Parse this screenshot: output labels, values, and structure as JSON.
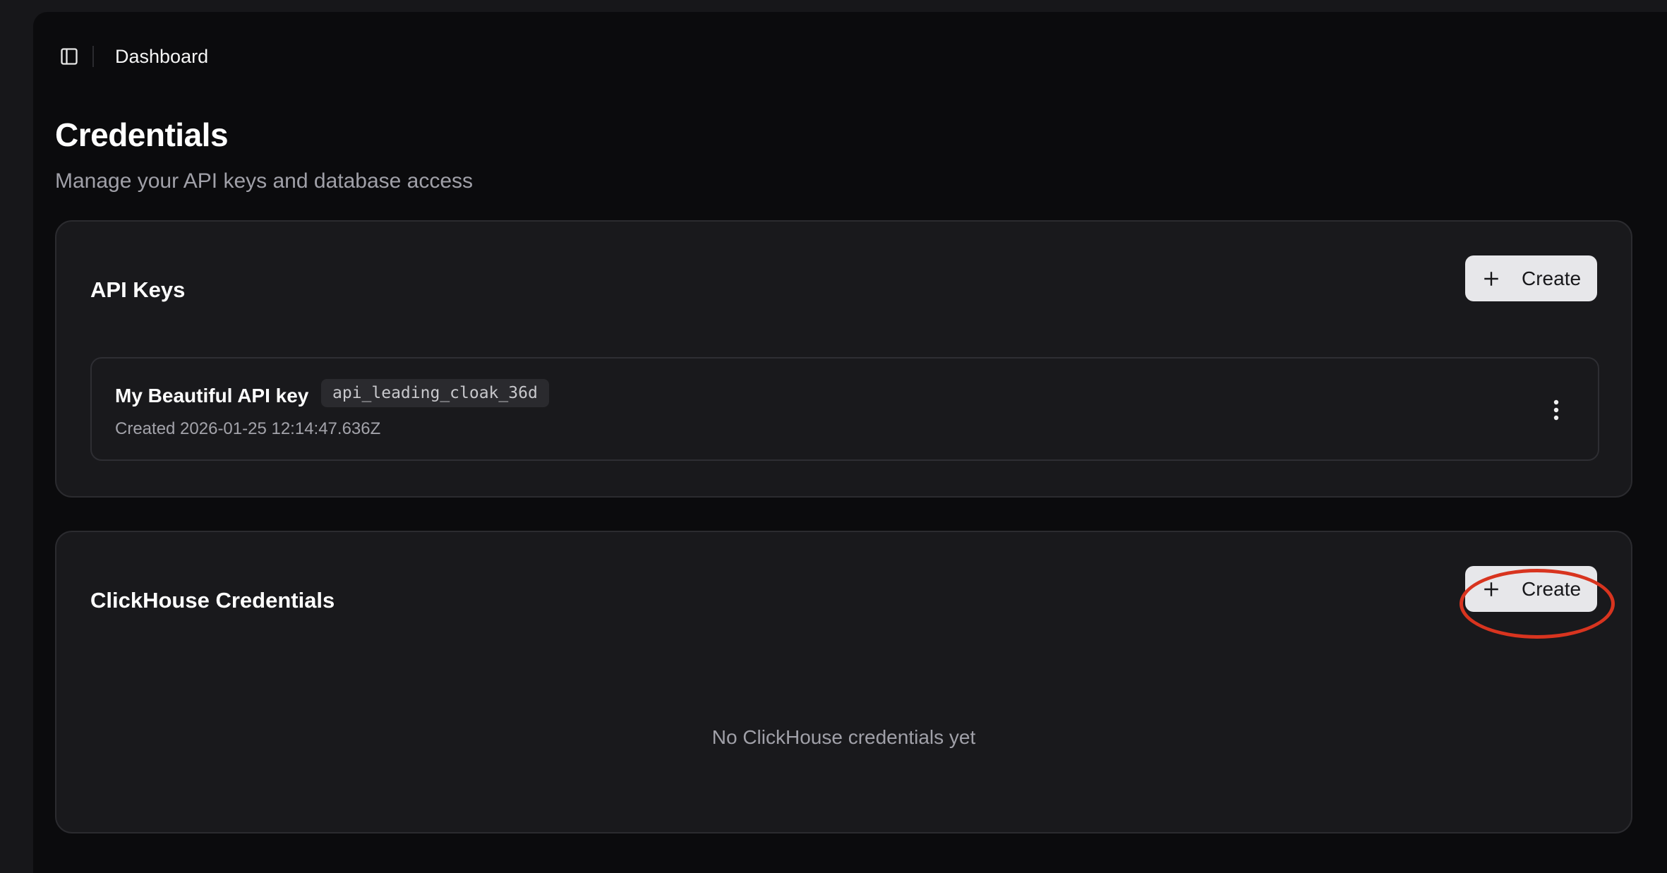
{
  "header": {
    "title": "Dashboard",
    "toggle_icon": "sidebar-toggle-icon"
  },
  "page": {
    "title": "Credentials",
    "subtitle": "Manage your API keys and database access"
  },
  "api_keys": {
    "title": "API Keys",
    "create_label": "Create",
    "items": [
      {
        "name": "My Beautiful API key",
        "key_id": "api_leading_cloak_36d",
        "created": "Created 2026-01-25 12:14:47.636Z"
      }
    ]
  },
  "clickhouse": {
    "title": "ClickHouse Credentials",
    "create_label": "Create",
    "empty_message": "No ClickHouse credentials yet"
  },
  "colors": {
    "page_bg": "#0b0b0d",
    "card_bg": "#19191c",
    "button_bg": "#e7e7ea",
    "highlight": "#d8341f"
  }
}
